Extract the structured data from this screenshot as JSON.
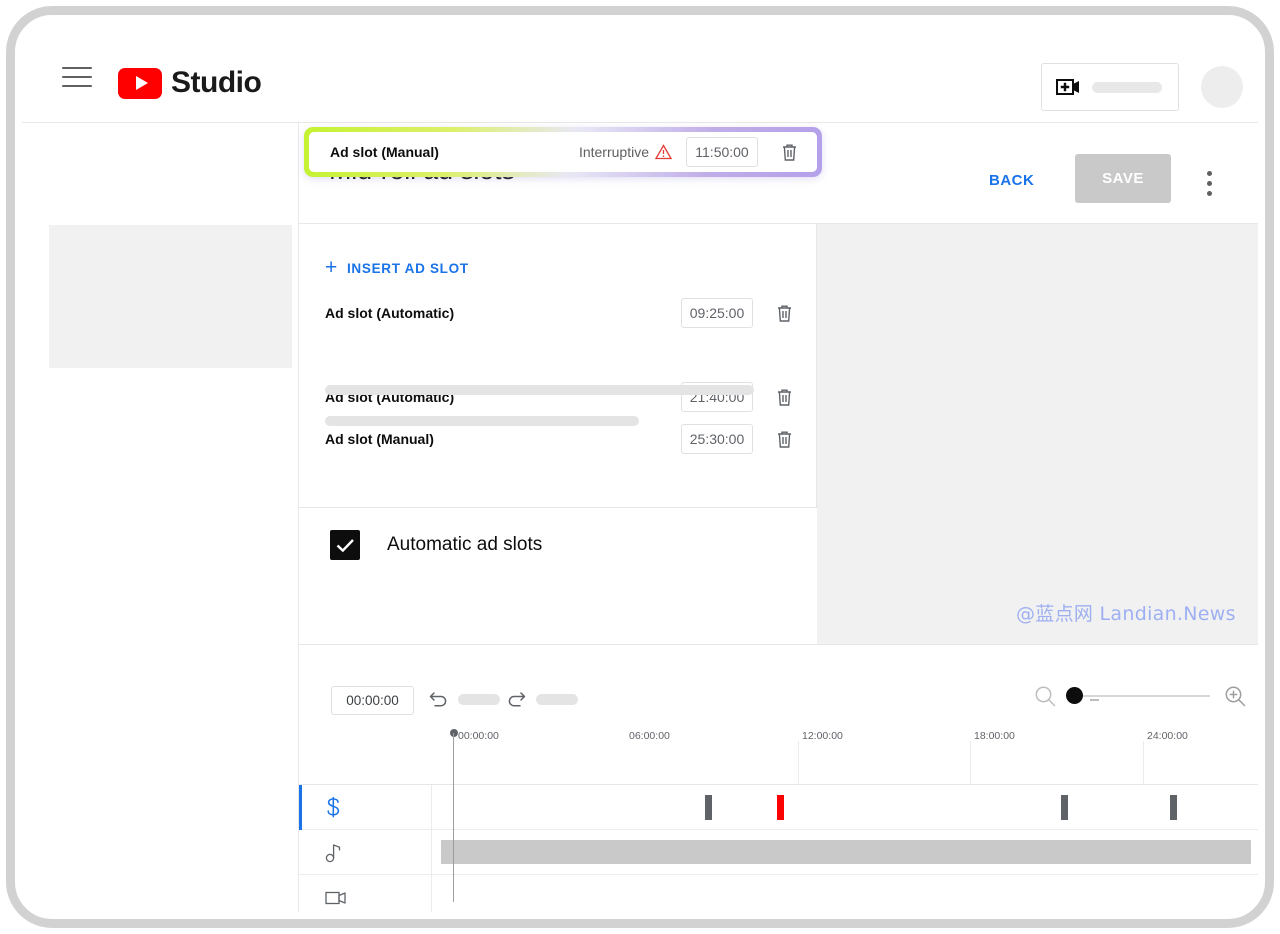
{
  "topbar": {
    "menu_icon": "hamburger-icon",
    "brand": "Studio",
    "create_icon": "video-plus-icon",
    "avatar_icon": "avatar"
  },
  "page": {
    "title": "Mid-roll ad slots",
    "back_label": "BACK",
    "save_label": "SAVE",
    "overflow_icon": "more-vert-icon"
  },
  "slots_panel": {
    "insert_label": "INSERT AD SLOT",
    "insert_icon": "plus-icon",
    "delete_icon": "trash-icon",
    "warning_icon": "warning-triangle-icon",
    "rows": [
      {
        "label": "Ad slot (Automatic)",
        "time": "09:25:00",
        "warning": "",
        "highlighted": false
      },
      {
        "label": "Ad slot (Manual)",
        "time": "11:50:00",
        "warning": "Interruptive",
        "highlighted": true
      },
      {
        "label": "Ad slot (Automatic)",
        "time": "21:40:00",
        "warning": "",
        "highlighted": false
      },
      {
        "label": "Ad slot (Manual)",
        "time": "25:30:00",
        "warning": "",
        "highlighted": false
      }
    ]
  },
  "auto_section": {
    "label": "Automatic ad slots",
    "checked": true,
    "check_icon": "checkmark-icon"
  },
  "watermark": "@蓝点网 Landian.News",
  "timeline": {
    "current_time": "00:00:00",
    "undo_icon": "undo-icon",
    "redo_icon": "redo-icon",
    "zoom_out_icon": "magnifier-minus-icon",
    "zoom_in_icon": "magnifier-plus-icon",
    "zoom_value": 5,
    "ruler_labels": [
      "00:00:00",
      "06:00:00",
      "12:00:00",
      "18:00:00",
      "24:00:00"
    ],
    "playhead_time": "00:00:00",
    "tracks": [
      {
        "name": "monetization-track",
        "icon": "dollar-icon",
        "active": true
      },
      {
        "name": "music-track",
        "icon": "music-note-icon",
        "active": false
      },
      {
        "name": "video-track",
        "icon": "video-camera-icon",
        "active": false
      }
    ],
    "ad_markers": [
      {
        "time": "09:25:00",
        "color": "#5f6368"
      },
      {
        "time": "11:50:00",
        "color": "#ff0000"
      },
      {
        "time": "21:40:00",
        "color": "#5f6368"
      },
      {
        "time": "25:30:00",
        "color": "#5f6368"
      }
    ]
  },
  "colors": {
    "brand_red": "#ff0000",
    "link_blue": "#1a73e8",
    "warning_red": "#e53935",
    "highlight_start": "#c4f231",
    "highlight_end": "#b4a0ea"
  }
}
